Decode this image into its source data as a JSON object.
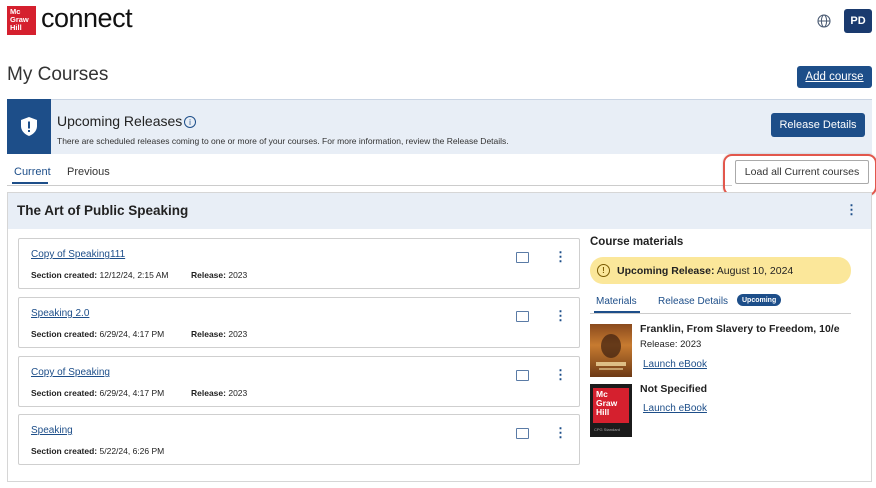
{
  "header": {
    "logo_lines": [
      "Mc",
      "Graw",
      "Hill"
    ],
    "brand": "connect",
    "avatar_initials": "PD"
  },
  "page": {
    "title": "My Courses",
    "add_course_label": "Add course"
  },
  "banner": {
    "title": "Upcoming Releases",
    "description": "There are scheduled releases coming to one or more of your courses. For more information, review the Release Details.",
    "button_label": "Release Details"
  },
  "tabs": {
    "current": "Current",
    "previous": "Previous",
    "load_all_label": "Load all Current courses"
  },
  "course": {
    "title": "The Art of Public Speaking",
    "sections": [
      {
        "name": "Copy of Speaking111",
        "created_label": "Section created:",
        "created": "12/12/24, 2:15 AM",
        "release_label": "Release:",
        "release": "2023"
      },
      {
        "name": "Speaking 2.0",
        "created_label": "Section created:",
        "created": "6/29/24, 4:17 PM",
        "release_label": "Release:",
        "release": "2023"
      },
      {
        "name": "Copy of Speaking",
        "created_label": "Section created:",
        "created": "6/29/24, 4:17 PM",
        "release_label": "Release:",
        "release": "2023"
      },
      {
        "name": "Speaking",
        "created_label": "Section created:",
        "created": "5/22/24, 6:26 PM",
        "release_label": "",
        "release": ""
      }
    ]
  },
  "materials": {
    "title": "Course materials",
    "upcoming_label": "Upcoming Release:",
    "upcoming_date": "August 10, 2024",
    "tab_materials": "Materials",
    "tab_release_details": "Release Details",
    "badge": "Upcoming",
    "books": [
      {
        "title": "Franklin, From Slavery to Freedom, 10/e",
        "release": "Release: 2023",
        "launch": "Launch eBook"
      },
      {
        "title": "Not Specified",
        "launch": "Launch eBook",
        "cover_lines": [
          "Mc",
          "Graw",
          "Hill"
        ],
        "cover_sub": "CPG Standard"
      }
    ]
  },
  "colors": {
    "primary": "#1d4e89",
    "brand_red": "#d5202e",
    "banner_bg": "#e8eef6",
    "highlight": "#e2574c",
    "upcoming_bg": "#fbe79a"
  }
}
